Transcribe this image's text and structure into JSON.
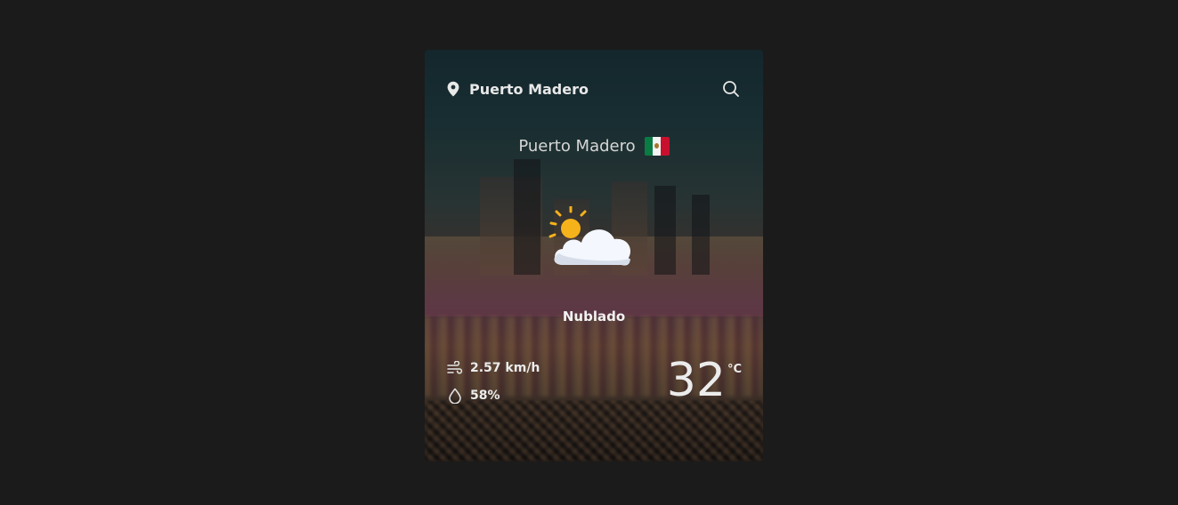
{
  "header": {
    "location_label": "Puerto Madero",
    "location_icon": "map-pin-icon",
    "search_icon": "search-icon"
  },
  "city": {
    "name": "Puerto Madero",
    "flag_icon": "mexico-flag-icon",
    "flag_colors": [
      "#0a7b43",
      "#f4f4f4",
      "#c8102e"
    ]
  },
  "weather": {
    "icon": "partly-cloudy-icon",
    "condition": "Nublado"
  },
  "stats": {
    "wind": {
      "icon": "wind-icon",
      "value": "2.57 km/h"
    },
    "humidity": {
      "icon": "droplet-icon",
      "value": "58%"
    }
  },
  "temperature": {
    "value": "32",
    "unit": "°C"
  },
  "colors": {
    "page_background": "#1b1b1b",
    "text": "#ececec",
    "sun": "#f6b21b",
    "cloud": "#f4f7fd"
  }
}
